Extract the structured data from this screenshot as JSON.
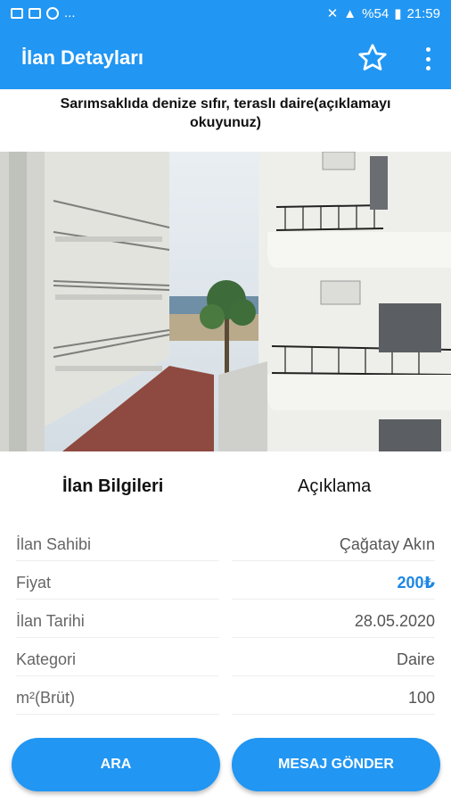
{
  "status_bar": {
    "left_dots": "...",
    "battery_percent": "%54",
    "time": "21:59"
  },
  "toolbar": {
    "title": "İlan Detayları",
    "favorite_icon": "star-outline-icon",
    "menu_icon": "more-vertical-icon"
  },
  "listing": {
    "headline": "Sarımsaklıda denize sıfır, teraslı daire(açıklamayı okuyunuz)"
  },
  "gallery": {
    "photo_description_icon": "apartment-photo",
    "page_count": 9,
    "active_index": 0
  },
  "tabs": [
    {
      "label": "İlan Bilgileri",
      "active": true
    },
    {
      "label": "Açıklama",
      "active": false
    }
  ],
  "details": [
    {
      "key": "İlan Sahibi",
      "value": "Çağatay Akın"
    },
    {
      "key": "Fiyat",
      "value": "200₺"
    },
    {
      "key": "İlan Tarihi",
      "value": "28.05.2020"
    },
    {
      "key": "Kategori",
      "value": "Daire"
    },
    {
      "key": "m²(Brüt)",
      "value": "100"
    }
  ],
  "actions": {
    "call_label": "ARA",
    "message_label": "MESAJ GÖNDER"
  },
  "colors": {
    "primary": "#2196f3",
    "price": "#1e88e5"
  }
}
